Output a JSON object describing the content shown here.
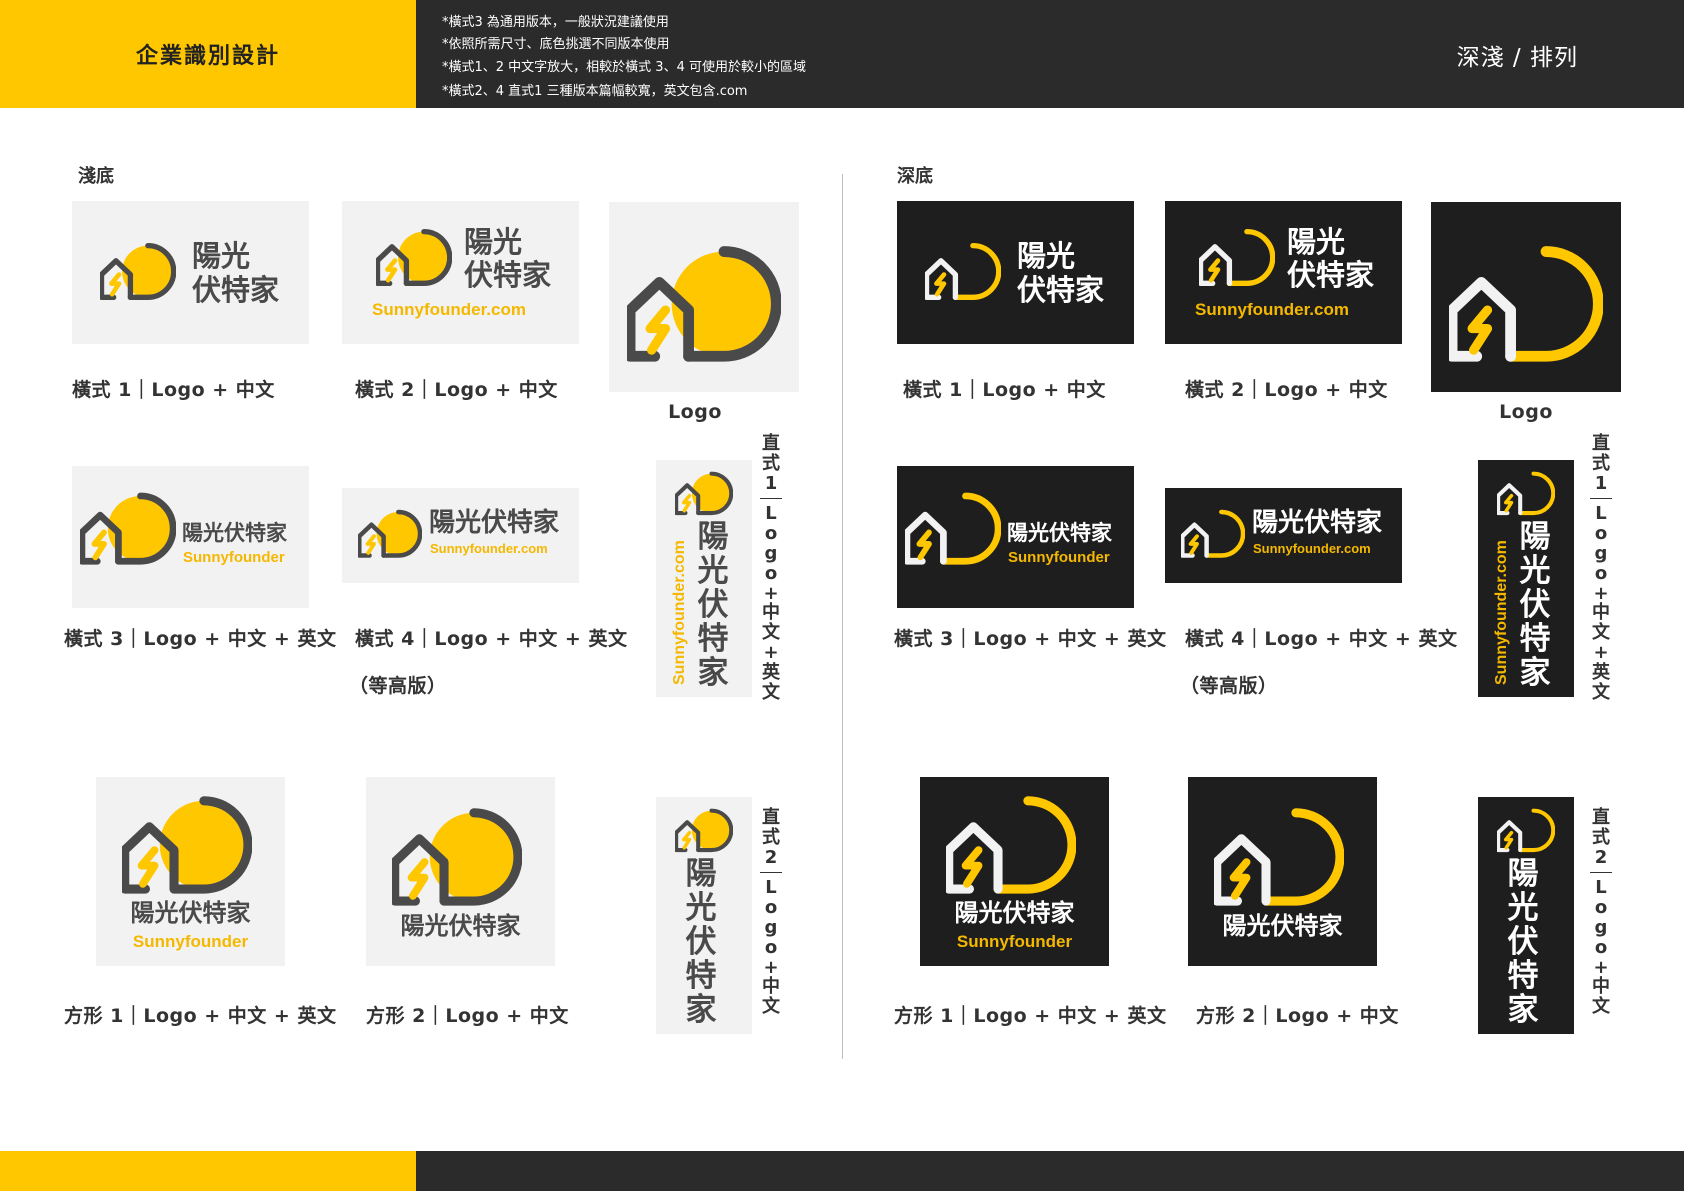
{
  "header": {
    "title": "企業識別設計",
    "notes": [
      "*橫式3 為通用版本，一般狀況建議使用",
      "*依照所需尺寸、底色挑選不同版本使用",
      "*橫式1、2 中文字放大，相較於橫式 3、4 可使用於較小的區域",
      "*橫式2、4 直式1 三種版本篇幅較寬，英文包含.com"
    ],
    "right_label": "深淺 / 排列"
  },
  "sections": {
    "light_label": "淺底",
    "dark_label": "深底"
  },
  "brand": {
    "zh": "陽光伏特家",
    "zh_line1": "陽光",
    "zh_line2": "伏特家",
    "en": "Sunnyfounder",
    "en_com": "Sunnyfounder.com"
  },
  "captions": {
    "h1": "橫式 1｜Logo + 中文",
    "h2": "橫式 2｜Logo + 中文",
    "logo": "Logo",
    "h3": "橫式 3｜Logo + 中文 + 英文",
    "h4": "橫式 4｜Logo + 中文 + 英文",
    "h4_note": "（等高版）",
    "sq1": "方形 1｜Logo + 中文 + 英文",
    "sq2": "方形 2｜Logo + 中文",
    "v1": [
      "直",
      "式",
      "1",
      "|",
      "L",
      "o",
      "g",
      "o",
      "+",
      "中",
      "文",
      "+",
      "英",
      "文"
    ],
    "v2": [
      "直",
      "式",
      "2",
      "|",
      "L",
      "o",
      "g",
      "o",
      "+",
      "中",
      "文"
    ]
  },
  "colors": {
    "brand_yellow": "#FFC700",
    "header_dark": "#2B2B2B",
    "light_bg": "#F2F2F2",
    "dark_bg": "#1E1E1E",
    "mark_gray": "#4A4A4A"
  },
  "icons": {
    "logo_mark": "house-with-sun-and-lightning-icon"
  }
}
